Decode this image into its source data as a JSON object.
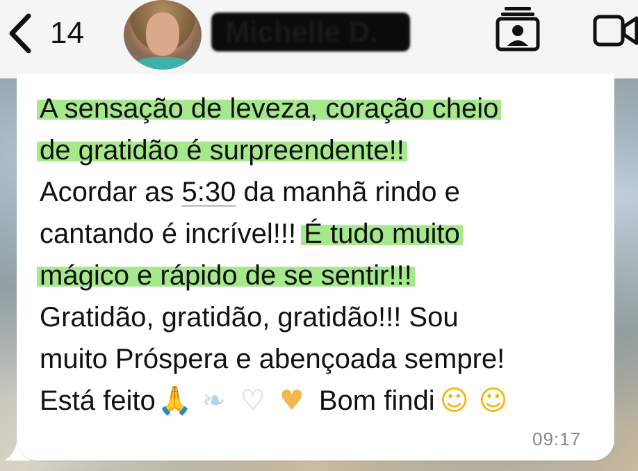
{
  "header": {
    "back_count": "14",
    "contact_name": "Michelle D."
  },
  "message": {
    "lines": [
      {
        "segments": [
          {
            "text": "A sensação de leveza, coração cheio",
            "highlight": true
          }
        ]
      },
      {
        "segments": [
          {
            "text": "de gratidão é surpreendente!!",
            "highlight": true
          }
        ]
      },
      {
        "segments": [
          {
            "text": "Acordar as ",
            "highlight": false
          },
          {
            "text": "5:30",
            "link": true
          },
          {
            "text": " da manhã rindo e",
            "highlight": false
          }
        ]
      },
      {
        "segments": [
          {
            "text": "cantando é incrível!!! ",
            "highlight": false
          },
          {
            "text": "É tudo muito",
            "highlight": true
          }
        ]
      },
      {
        "segments": [
          {
            "text": "mágico e rápido de se sentir!!!",
            "highlight": true
          }
        ]
      },
      {
        "segments": [
          {
            "text": "Gratidão,  gratidão,  gratidão!!! Sou",
            "highlight": false
          }
        ]
      },
      {
        "segments": [
          {
            "text": "muito Próspera e abençoada sempre!",
            "highlight": false
          }
        ]
      }
    ],
    "last_line": {
      "text_start": "Está feito",
      "emojis": [
        "pray-emoji",
        "wing-emoji",
        "white-heart-emoji",
        "heart-hands-emoji"
      ],
      "text_end": " Bom findi",
      "emojis_end": [
        "kissing-heart-emoji",
        "kissing-heart-emoji"
      ]
    },
    "time": "09:17"
  },
  "colors": {
    "highlight": "#a6e88c",
    "bubble": "#ffffff",
    "header_bg": "#f5f5f5"
  }
}
